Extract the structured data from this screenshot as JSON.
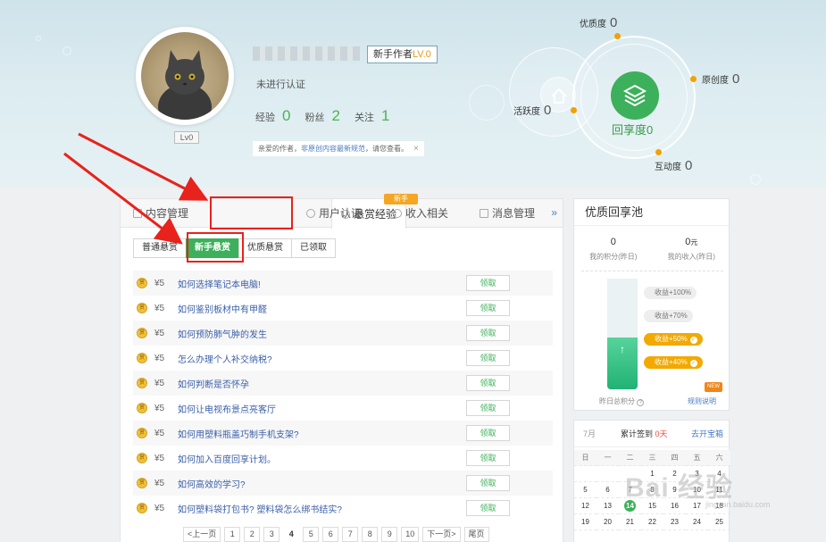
{
  "profile": {
    "avatar_level": "Lv0",
    "author_badge": "新手作者",
    "author_level": "LV.0",
    "verify_status": "未进行认证",
    "stats": [
      {
        "label": "经验",
        "value": "0"
      },
      {
        "label": "粉丝",
        "value": "2"
      },
      {
        "label": "关注",
        "value": "1"
      }
    ],
    "notice": {
      "prefix": "亲爱的作者，",
      "link": "非原创内容最新规范",
      "suffix": "，请您查看。",
      "close": "×"
    }
  },
  "metrics": {
    "quality": {
      "label": "优质度",
      "value": "0"
    },
    "original": {
      "label": "原创度",
      "value": "0"
    },
    "activity": {
      "label": "活跃度",
      "value": "0"
    },
    "interaction": {
      "label": "互动度",
      "value": "0"
    },
    "core": {
      "label": "回享度",
      "value": "0"
    }
  },
  "tabs": [
    {
      "label": "内容管理"
    },
    {
      "label": "悬赏经验",
      "tag": "新手"
    },
    {
      "label": "用户认证"
    },
    {
      "label": "收入相关"
    },
    {
      "label": "消息管理"
    }
  ],
  "tabs_more": "»",
  "subtabs": [
    "普通悬赏",
    "新手悬赏",
    "优质悬赏",
    "已领取"
  ],
  "coin_glyph": "赏",
  "claim_label": "领取",
  "tasks": [
    {
      "reward": "¥5",
      "title": "如何选择笔记本电脑!"
    },
    {
      "reward": "¥5",
      "title": "如何鉴别板材中有甲醛"
    },
    {
      "reward": "¥5",
      "title": "如何预防肺气肿的发生"
    },
    {
      "reward": "¥5",
      "title": "怎么办理个人补交纳税?"
    },
    {
      "reward": "¥5",
      "title": "如何判断是否怀孕"
    },
    {
      "reward": "¥5",
      "title": "如何让电视布景点亮客厅"
    },
    {
      "reward": "¥5",
      "title": "如何用塑料瓶盖巧制手机支架?"
    },
    {
      "reward": "¥5",
      "title": "如何加入百度回享计划。"
    },
    {
      "reward": "¥5",
      "title": "如何高效的学习?"
    },
    {
      "reward": "¥5",
      "title": "如何塑料袋打包书? 塑料袋怎么绑书结实?"
    }
  ],
  "pager": {
    "prev": "<上一页",
    "pages": [
      "1",
      "2",
      "3",
      "4",
      "5",
      "6",
      "7",
      "8",
      "9",
      "10"
    ],
    "current": "4",
    "next": "下一页>",
    "last": "尾页"
  },
  "pool": {
    "title": "优质回享池",
    "points_value": "0",
    "points_label": "我的积分(昨日)",
    "income_value": "0",
    "income_unit": "元",
    "income_label": "我的收入(昨日)",
    "fill_fraction": 0.47,
    "arrow": "↑",
    "levels": [
      {
        "label": "收益+100%",
        "active": false
      },
      {
        "label": "收益+70%",
        "active": false
      },
      {
        "label": "收益+50%",
        "active": true
      },
      {
        "label": "收益+40%",
        "active": true
      }
    ],
    "check_glyph": "✓",
    "footer_left": "昨日总积分",
    "help_glyph": "?",
    "footer_right": "规则说明",
    "new_tag": "NEW"
  },
  "calendar": {
    "month": "7月",
    "signed_prefix": "累计签到",
    "signed_days": "0天",
    "treasure": "去开宝箱",
    "weekdays": [
      "日",
      "一",
      "二",
      "三",
      "四",
      "五",
      "六"
    ],
    "days": [
      "",
      "",
      "",
      "1",
      "2",
      "3",
      "4",
      "5",
      "6",
      "7",
      "8",
      "9",
      "10",
      "11",
      "12",
      "13",
      "14",
      "15",
      "16",
      "17",
      "18",
      "19",
      "20",
      "21",
      "22",
      "23",
      "24",
      "25"
    ],
    "today": "14"
  },
  "watermark": "Bai 经验",
  "watermark_sub": "jingyan.baidu.com",
  "colors": {
    "accent_green": "#3cb05a",
    "orange": "#f2a200",
    "annotation_red": "#e8221c",
    "link_blue": "#4a7cc2"
  }
}
